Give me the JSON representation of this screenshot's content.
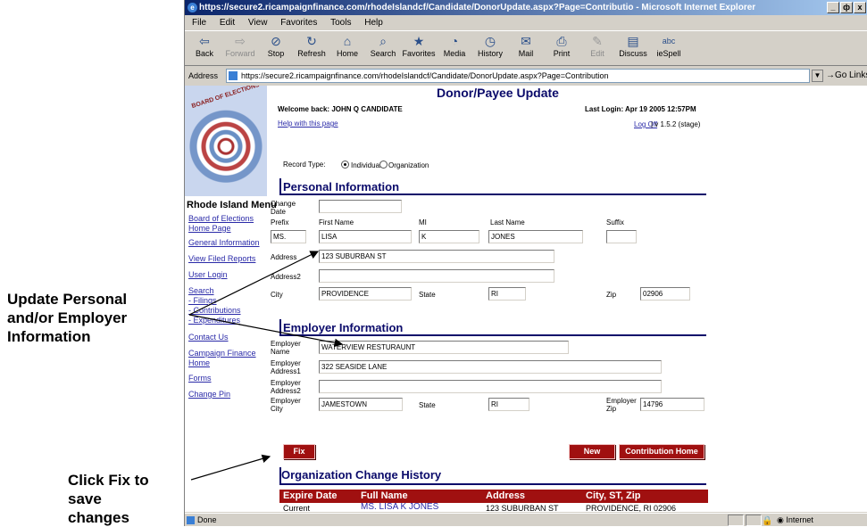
{
  "annotations": {
    "update_note": [
      "Update Personal",
      "and/or Employer",
      "Information"
    ],
    "fix_note": [
      "Click Fix to",
      "save",
      "changes"
    ]
  },
  "window": {
    "title": "https://secure2.ricampaignfinance.com/rhodeIslandcf/Candidate/DonorUpdate.aspx?Page=Contributio - Microsoft Internet Explorer",
    "controls": [
      "_",
      "ф",
      "x"
    ],
    "menu": [
      "File",
      "Edit",
      "View",
      "Favorites",
      "Tools",
      "Help"
    ],
    "toolbar": [
      {
        "label": "Back",
        "icon": "⇦"
      },
      {
        "label": "Forward",
        "icon": "⇨"
      },
      {
        "label": "Stop",
        "icon": "⊘"
      },
      {
        "label": "Refresh",
        "icon": "↻"
      },
      {
        "label": "Home",
        "icon": "⌂"
      },
      {
        "label": "Search",
        "icon": "⌕"
      },
      {
        "label": "Favorites",
        "icon": "★"
      },
      {
        "label": "Media",
        "icon": "◔"
      },
      {
        "label": "History",
        "icon": "◷"
      },
      {
        "label": "Mail",
        "icon": "✉"
      },
      {
        "label": "Print",
        "icon": "⎙"
      },
      {
        "label": "Edit",
        "icon": "✎"
      },
      {
        "label": "Discuss",
        "icon": "▤"
      },
      {
        "label": "ieSpell",
        "icon": "abc"
      }
    ],
    "address_label": "Address",
    "address_url": "https://secure2.ricampaignfinance.com/rhodeIslandcf/Candidate/DonorUpdate.aspx?Page=Contribution",
    "go_label": "Go",
    "links_label": "Links",
    "status_text": "Done",
    "zone_label": "Internet"
  },
  "page": {
    "title": "Donor/Payee Update",
    "welcome": "Welcome back: JOHN Q CANDIDATE",
    "last_login": "Last Login: Apr 19 2005 12:57PM",
    "help_link": "Help with this page",
    "logoff": "Log Off",
    "version": "| v 1.5.2 (stage)",
    "logo_text": "BOARD OF ELECTIONS",
    "record_type_label": "Record Type:",
    "record_options": [
      {
        "label": "Individual",
        "selected": true
      },
      {
        "label": "Organization",
        "selected": false
      }
    ]
  },
  "nav": {
    "title": "Rhode Island Menu",
    "items": [
      "Board of Elections",
      "Home Page",
      "General Information",
      "View Filed Reports",
      "User Login",
      "Search",
      "- Filings",
      "- Contributions",
      "- Expenditures",
      "Contact Us",
      "Campaign Finance",
      "Home",
      "Forms",
      "Change Pin"
    ]
  },
  "personal": {
    "heading": "Personal Information",
    "change_date_label": "Change Date",
    "change_date": "",
    "prefix_label": "Prefix",
    "first_label": "First Name",
    "mi_label": "MI",
    "last_label": "Last Name",
    "suffix_label": "Suffix",
    "prefix": "MS.",
    "first": "LISA",
    "mi": "K",
    "last": "JONES",
    "suffix": "",
    "address_label": "Address",
    "address": "123 SUBURBAN ST",
    "address2_label": "Address2",
    "address2": "",
    "city_label": "City",
    "city": "PROVIDENCE",
    "state_label": "State",
    "state": "RI",
    "zip_label": "Zip",
    "zip": "02906"
  },
  "employer": {
    "heading": "Employer Information",
    "name_label": "Employer Name",
    "name": "WATERVIEW RESTURAUNT",
    "addr1_label": "Employer Address1",
    "addr1": "322 SEASIDE LANE",
    "addr2_label": "Employer Address2",
    "addr2": "",
    "city_label": "Employer City",
    "city": "JAMESTOWN",
    "state_label": "State",
    "state": "RI",
    "zip_label": "Employer Zip",
    "zip": "14796"
  },
  "buttons": {
    "fix": "Fix",
    "new_search": "New Search",
    "contribution_home": "Contribution Home"
  },
  "history": {
    "heading": "Organization Change History",
    "columns": [
      "Expire Date",
      "Full Name",
      "Address",
      "City, ST, Zip"
    ],
    "rows": [
      [
        "Current",
        "MS. LISA K JONES",
        "123 SUBURBAN ST",
        "PROVIDENCE, RI 02906"
      ]
    ]
  }
}
